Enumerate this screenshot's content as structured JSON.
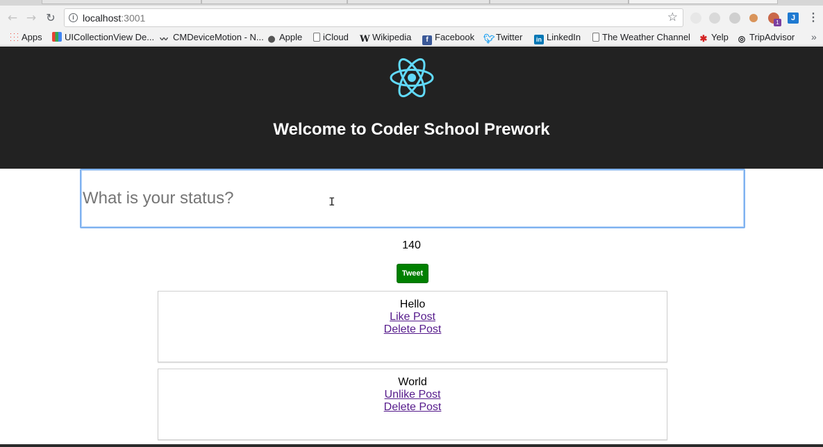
{
  "browser": {
    "url_host": "localhost",
    "url_port": ":3001",
    "icons": {
      "back": "back-arrow-icon",
      "forward": "forward-arrow-icon",
      "reload": "reload-icon",
      "info": "info-icon",
      "star": "bookmark-star-icon",
      "menu": "menu-dots-icon"
    },
    "extension_badge": "1",
    "extension_j_label": "J",
    "bookmarks": [
      {
        "label": "Apps",
        "icon": "apps-grid-icon"
      },
      {
        "label": "UICollectionView De...",
        "icon": "colorful-grid-icon"
      },
      {
        "label": "CMDeviceMotion - N...",
        "icon": "mustache-icon"
      },
      {
        "label": "Apple",
        "icon": "apple-icon"
      },
      {
        "label": "iCloud",
        "icon": "page-icon"
      },
      {
        "label": "Wikipedia",
        "icon": "wikipedia-icon"
      },
      {
        "label": "Facebook",
        "icon": "facebook-icon"
      },
      {
        "label": "Twitter",
        "icon": "twitter-icon"
      },
      {
        "label": "LinkedIn",
        "icon": "linkedin-icon"
      },
      {
        "label": "The Weather Channel",
        "icon": "page-icon"
      },
      {
        "label": "Yelp",
        "icon": "yelp-icon"
      },
      {
        "label": "TripAdvisor",
        "icon": "tripadvisor-icon"
      }
    ],
    "bookmarks_overflow": "»"
  },
  "app": {
    "title": "Welcome to Coder School Prework",
    "logo_icon": "react-atom-logo",
    "accent_color": "#61dafb",
    "status_placeholder": "What is your status?",
    "status_value": "",
    "char_count": "140",
    "tweet_label": "Tweet",
    "tweet_color": "#008000",
    "posts": [
      {
        "text": "Hello",
        "like_label": "Like Post",
        "delete_label": "Delete Post"
      },
      {
        "text": "World",
        "like_label": "Unlike Post",
        "delete_label": "Delete Post"
      }
    ]
  }
}
